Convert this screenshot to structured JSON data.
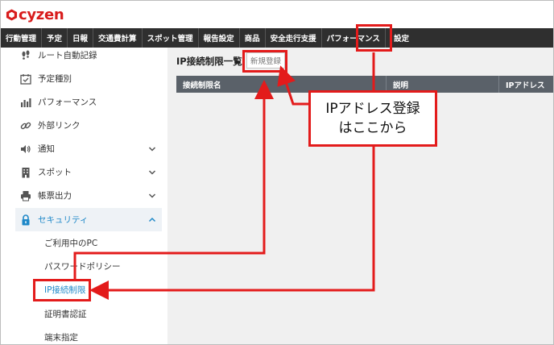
{
  "app": {
    "logo_text": "cyzen"
  },
  "nav": [
    {
      "label": "行動管理"
    },
    {
      "label": "予定"
    },
    {
      "label": "日報"
    },
    {
      "label": "交通費計算"
    },
    {
      "label": "スポット管理"
    },
    {
      "label": "報告設定"
    },
    {
      "label": "商品"
    },
    {
      "label": "安全走行支援"
    },
    {
      "label": "パフォーマンス"
    },
    {
      "label": "設定"
    }
  ],
  "sidebar": {
    "items": [
      {
        "label": "ルート自動記録",
        "icon": "footprints-icon"
      },
      {
        "label": "予定種別",
        "icon": "calendar-check-icon"
      },
      {
        "label": "パフォーマンス",
        "icon": "bar-chart-icon"
      },
      {
        "label": "外部リンク",
        "icon": "link-icon"
      },
      {
        "label": "通知",
        "icon": "speaker-icon"
      },
      {
        "label": "スポット",
        "icon": "building-icon"
      },
      {
        "label": "帳票出力",
        "icon": "printer-icon"
      },
      {
        "label": "セキュリティ",
        "icon": "lock-icon"
      }
    ],
    "sub_items": [
      {
        "label": "ご利用中のPC"
      },
      {
        "label": "パスワードポリシー"
      },
      {
        "label": "IP接続制限"
      },
      {
        "label": "証明書認証"
      },
      {
        "label": "端末指定"
      }
    ]
  },
  "main": {
    "title": "IP接続制限一覧",
    "new_button": "新規登録",
    "table_headers": [
      "接続制限名",
      "説明",
      "IPアドレス"
    ]
  },
  "callout": {
    "line1": "IPアドレス登録",
    "line2": "はここから"
  },
  "colors": {
    "accent": "#1e88c8",
    "annotation": "#e31b1b",
    "nav_bg": "#2f2f2f",
    "logo": "#d81c1c"
  }
}
